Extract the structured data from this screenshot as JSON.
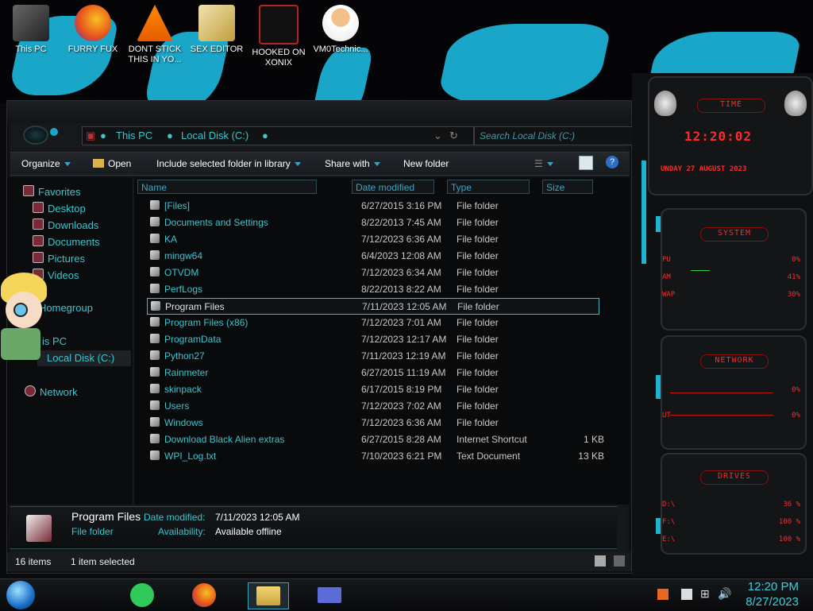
{
  "desktop": {
    "icons": [
      {
        "label": "This PC",
        "color": "#555"
      },
      {
        "label": "FURRY FUX",
        "color": "#e96f1f"
      },
      {
        "label": "DONT STICK\nTHIS IN YO...",
        "color": "#f07d00"
      },
      {
        "label": "SEX EDITOR",
        "color": "#d9c07a"
      },
      {
        "label": "HOOKED ON\nXONIX",
        "color": "#b92323"
      },
      {
        "label": "VM0Technic...",
        "color": "#e9a25a"
      }
    ]
  },
  "explorer": {
    "breadcrumb": [
      "This PC",
      "Local Disk (C:)"
    ],
    "search_placeholder": "Search Local Disk (C:)",
    "toolbar": {
      "organize": "Organize",
      "open": "Open",
      "include": "Include selected folder in library",
      "share": "Share with",
      "new_folder": "New folder"
    },
    "nav": {
      "favorites": "Favorites",
      "desktop": "Desktop",
      "downloads": "Downloads",
      "documents": "Documents",
      "pictures": "Pictures",
      "videos": "Videos",
      "homegroup": "Homegroup",
      "this_pc": "is PC",
      "local_disk": "Local Disk (C:)",
      "network": "Network"
    },
    "columns": {
      "name": "Name",
      "date": "Date modified",
      "type": "Type",
      "size": "Size"
    },
    "files": [
      {
        "name": "[Files]",
        "date": "6/27/2015 3:16 PM",
        "type": "File folder",
        "size": ""
      },
      {
        "name": "Documents and Settings",
        "date": "8/22/2013 7:45 AM",
        "type": "File folder",
        "size": ""
      },
      {
        "name": "KA",
        "date": "7/12/2023 6:36 AM",
        "type": "File folder",
        "size": ""
      },
      {
        "name": "mingw64",
        "date": "6/4/2023 12:08 AM",
        "type": "File folder",
        "size": ""
      },
      {
        "name": "OTVDM",
        "date": "7/12/2023 6:34 AM",
        "type": "File folder",
        "size": ""
      },
      {
        "name": "PerfLogs",
        "date": "8/22/2013 8:22 AM",
        "type": "File folder",
        "size": ""
      },
      {
        "name": "Program Files",
        "date": "7/11/2023 12:05 AM",
        "type": "File folder",
        "size": ""
      },
      {
        "name": "Program Files (x86)",
        "date": "7/12/2023 7:01 AM",
        "type": "File folder",
        "size": ""
      },
      {
        "name": "ProgramData",
        "date": "7/12/2023 12:17 AM",
        "type": "File folder",
        "size": ""
      },
      {
        "name": "Python27",
        "date": "7/11/2023 12:19 AM",
        "type": "File folder",
        "size": ""
      },
      {
        "name": "Rainmeter",
        "date": "6/27/2015 11:19 AM",
        "type": "File folder",
        "size": ""
      },
      {
        "name": "skinpack",
        "date": "6/17/2015 8:19 PM",
        "type": "File folder",
        "size": ""
      },
      {
        "name": "Users",
        "date": "7/12/2023 7:02 AM",
        "type": "File folder",
        "size": ""
      },
      {
        "name": "Windows",
        "date": "7/12/2023 6:36 AM",
        "type": "File folder",
        "size": ""
      },
      {
        "name": "Download Black Alien extras",
        "date": "6/27/2015 8:28 AM",
        "type": "Internet Shortcut",
        "size": "1 KB"
      },
      {
        "name": "WPI_Log.txt",
        "date": "7/10/2023 6:21 PM",
        "type": "Text Document",
        "size": "13 KB"
      }
    ],
    "details": {
      "name": "Program Files",
      "type": "File folder",
      "date_label": "Date modified:",
      "date_value": "7/11/2023 12:05 AM",
      "avail_label": "Availability:",
      "avail_value": "Available offline"
    },
    "status": {
      "items": "16 items",
      "selected": "1 item selected"
    }
  },
  "widget": {
    "time_title": "TIME",
    "time": "12:20:02",
    "date": "UNDAY 27 AUGUST 2023",
    "system_title": "SYSTEM",
    "system": [
      {
        "label": "PU",
        "value": "0%"
      },
      {
        "label": "AM",
        "value": "41%"
      },
      {
        "label": "WAP",
        "value": "30%"
      }
    ],
    "network_title": "NETWORK",
    "network": [
      {
        "label": "",
        "value": "0%"
      },
      {
        "label": "UT",
        "value": "0%"
      }
    ],
    "drives_title": "DRIVES",
    "drives": [
      {
        "label": "D:\\",
        "value": "36 %"
      },
      {
        "label": "F:\\",
        "value": "100 %"
      },
      {
        "label": "E:\\",
        "value": "100 %"
      }
    ]
  },
  "taskbar": {
    "time": "12:20 PM",
    "date": "8/27/2023"
  }
}
